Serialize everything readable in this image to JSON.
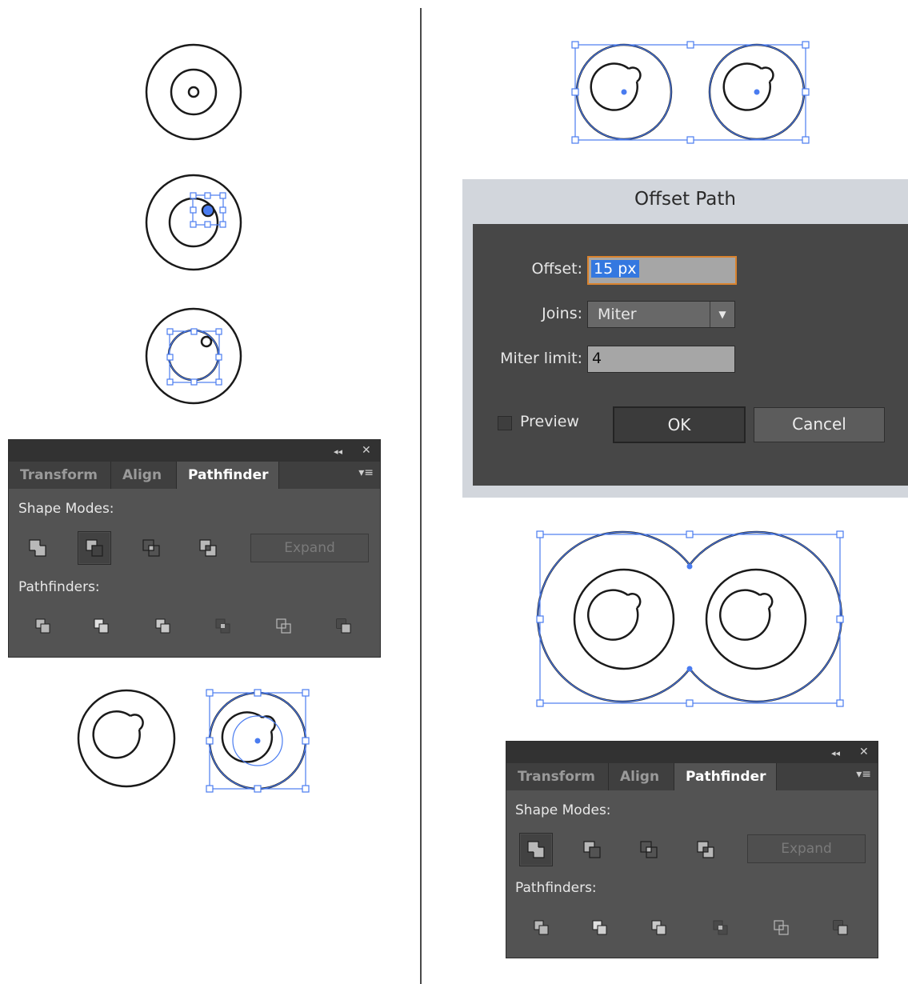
{
  "colors": {
    "selection": "#4a7cf0",
    "panel_bg": "#535353",
    "dialog_title_bg": "#d2d6dc",
    "focus": "#d9832e"
  },
  "pathfinder_panels": [
    {
      "collapse_icon": "◂◂",
      "close_icon": "✕",
      "tabs": [
        "Transform",
        "Align",
        "Pathfinder"
      ],
      "active_tab": "Pathfinder",
      "menu_icon": "▾≡",
      "shape_modes_label": "Shape Modes:",
      "pathfinders_label": "Pathfinders:",
      "expand_label": "Expand",
      "shape_mode_icons": [
        "unite-icon",
        "minus-front-icon",
        "intersect-icon",
        "exclude-icon"
      ],
      "pathfinder_icons": [
        "divide-icon",
        "trim-icon",
        "merge-icon",
        "crop-icon",
        "outline-icon",
        "minus-back-icon"
      ],
      "pressed_shape_mode": "minus-front-icon"
    },
    {
      "collapse_icon": "◂◂",
      "close_icon": "✕",
      "tabs": [
        "Transform",
        "Align",
        "Pathfinder"
      ],
      "active_tab": "Pathfinder",
      "menu_icon": "▾≡",
      "shape_modes_label": "Shape Modes:",
      "pathfinders_label": "Pathfinders:",
      "expand_label": "Expand",
      "shape_mode_icons": [
        "unite-icon",
        "minus-front-icon",
        "intersect-icon",
        "exclude-icon"
      ],
      "pathfinder_icons": [
        "divide-icon",
        "trim-icon",
        "merge-icon",
        "crop-icon",
        "outline-icon",
        "minus-back-icon"
      ],
      "pressed_shape_mode": "unite-icon"
    }
  ],
  "offset_dialog": {
    "title": "Offset Path",
    "offset_label": "Offset:",
    "offset_value": "15 px",
    "joins_label": "Joins:",
    "joins_value": "Miter",
    "miter_label": "Miter limit:",
    "miter_value": "4",
    "preview_label": "Preview",
    "preview_checked": false,
    "ok_label": "OK",
    "cancel_label": "Cancel"
  }
}
